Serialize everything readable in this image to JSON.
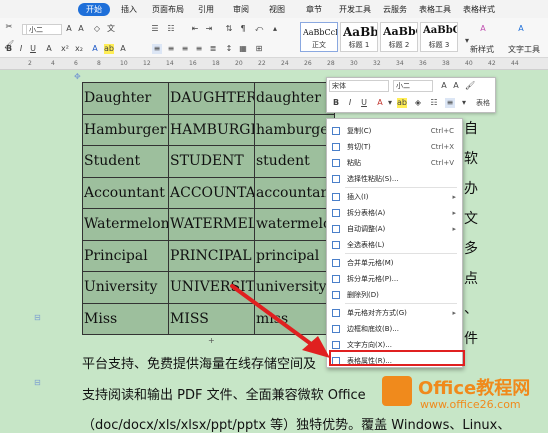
{
  "tabs": [
    "开始",
    "插入",
    "页面布局",
    "引用",
    "审阅",
    "视图",
    "章节",
    "开发工具",
    "云服务",
    "表格工具",
    "表格样式"
  ],
  "ribbon": {
    "font_name": "",
    "font_size": "小二",
    "styles": [
      {
        "sample": "AaBbCcDd",
        "name": "正文"
      },
      {
        "sample": "AaBb",
        "name": "标题 1"
      },
      {
        "sample": "AaBbC",
        "name": "标题 2"
      },
      {
        "sample": "AaBbC",
        "name": "标题 3"
      }
    ],
    "new_style": "新样式",
    "text_tools": "文字工具"
  },
  "ruler": [
    "2",
    "4",
    "6",
    "8",
    "10",
    "12",
    "14",
    "16",
    "18",
    "20",
    "22",
    "24",
    "26",
    "28",
    "30",
    "32",
    "34",
    "36",
    "38",
    "40",
    "42",
    "44"
  ],
  "table": {
    "rows": [
      [
        "Daughter",
        "DAUGHTER",
        "daughter"
      ],
      [
        "Hamburger",
        "HAMBURGER",
        "hamburger"
      ],
      [
        "Student",
        "STUDENT",
        "student"
      ],
      [
        "Accountant",
        "ACCOUNTANT",
        "accountant"
      ],
      [
        "Watermelon",
        "WATERMELON",
        "watermelon"
      ],
      [
        "Principal",
        "PRINCIPAL",
        "principal"
      ],
      [
        "University",
        "UNIVERSITY",
        "university"
      ],
      [
        "Miss",
        "MISS",
        "miss"
      ]
    ]
  },
  "body_text": {
    "line1": "平台支持、免费提供海量在线存储空间及",
    "line2": "支持阅读和输出 PDF 文件、全面兼容微软 Office",
    "line3": "（doc/docx/xls/xlsx/ppt/pptx 等）独特优势。覆盖 Windows、Linux、",
    "vertical_chars": [
      "自",
      "软",
      "办",
      "文",
      "多",
      "点",
      "、",
      "件"
    ]
  },
  "float_toolbar": {
    "font": "宋体",
    "size": "小二",
    "buttons": [
      "B",
      "I",
      "U",
      "A",
      "▾",
      "≡",
      "表格"
    ]
  },
  "context_menu": {
    "items": [
      {
        "label": "复制(C)",
        "key": "Ctrl+C"
      },
      {
        "label": "剪切(T)",
        "key": "Ctrl+X"
      },
      {
        "label": "粘贴",
        "key": "Ctrl+V"
      },
      {
        "label": "选择性粘贴(S)...",
        "key": ""
      },
      {
        "label": "插入(I)",
        "key": "",
        "submenu": true
      },
      {
        "label": "拆分表格(A)",
        "key": "",
        "submenu": true
      },
      {
        "label": "自动调整(A)",
        "key": "",
        "submenu": true
      },
      {
        "label": "全选表格(L)",
        "key": ""
      },
      {
        "label": "合并单元格(M)",
        "key": ""
      },
      {
        "label": "拆分单元格(P)...",
        "key": ""
      },
      {
        "label": "删除列(D)",
        "key": ""
      },
      {
        "label": "单元格对齐方式(G)",
        "key": "",
        "submenu": true
      },
      {
        "label": "边框和底纹(B)...",
        "key": ""
      },
      {
        "label": "文字方向(X)...",
        "key": ""
      },
      {
        "label": "表格属性(R)...",
        "key": ""
      }
    ]
  },
  "watermark": {
    "brand": "Office教程网",
    "url": "www.office26.com"
  },
  "colors": {
    "page_bg": "#c7e6c7",
    "table_bg": "#9dbf9d",
    "highlight": "#e02020",
    "brand": "#f08a1c",
    "active_tab": "#1e6fd9"
  }
}
